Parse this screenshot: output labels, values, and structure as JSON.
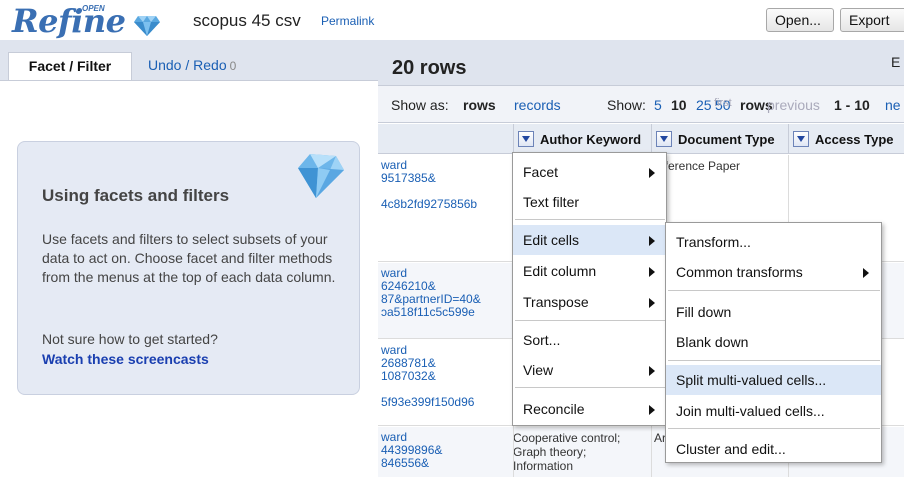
{
  "app": {
    "logo_text": "Refine",
    "logo_superscript": "OPEN",
    "project_title": "scopus 45 csv",
    "permalink": "Permalink",
    "open_button": "Open...",
    "export_button": "Export"
  },
  "left_panel": {
    "tab_facet": "Facet / Filter",
    "tab_undo": "Undo / Redo",
    "undo_count": "0",
    "help_title": "Using facets and filters",
    "help_text": "Use facets and filters to select subsets of your data to act on. Choose facet and filter methods from the menus at the top of each data column.",
    "help_question": "Not sure how to get started?",
    "help_link": "Watch these screencasts"
  },
  "data_area": {
    "rows_count": "20 rows",
    "rows_extra": "E",
    "view": {
      "show_as_label": "Show as:",
      "rows": "rows",
      "records": "records",
      "show_label": "Show:",
      "size_5": "5",
      "size_10": "10",
      "size_25": "25",
      "size_50": "50",
      "size_rows": "rows",
      "overlap_first": "first",
      "previous": "previous",
      "range": "1 - 10",
      "next": "ne"
    },
    "columns": [
      {
        "label": "Author Keyword"
      },
      {
        "label": "Document Type"
      },
      {
        "label": "Access Type"
      }
    ],
    "rows": [
      {
        "lines": [
          "ward",
          "9517385&",
          "",
          "4c8b2fd9275856b"
        ],
        "doc_type": "nference Paper"
      },
      {
        "lines": [
          "ward",
          "6246210&",
          "87&partnerID=40&",
          "ɔa518f11c5c599e"
        ]
      },
      {
        "lines": [
          "ward",
          "2688781&",
          "1087032&",
          "",
          "5f93e399f150d96"
        ]
      },
      {
        "lines": [
          "ward",
          "44399896&",
          "846556&"
        ],
        "keywords": [
          "Cooperative control;",
          "Graph theory;",
          "Information"
        ],
        "doc_type": "Ar"
      }
    ]
  },
  "column_menu": {
    "items": [
      {
        "label": "Facet",
        "submenu": true
      },
      {
        "label": "Text filter",
        "submenu": false
      },
      {
        "label": "Edit cells",
        "submenu": true,
        "highlighted": true
      },
      {
        "label": "Edit column",
        "submenu": true
      },
      {
        "label": "Transpose",
        "submenu": true
      },
      {
        "label": "Sort...",
        "submenu": false
      },
      {
        "label": "View",
        "submenu": true
      },
      {
        "label": "Reconcile",
        "submenu": true
      }
    ]
  },
  "edit_cells_menu": {
    "items": [
      {
        "label": "Transform...",
        "submenu": false
      },
      {
        "label": "Common transforms",
        "submenu": true
      },
      {
        "label": "Fill down",
        "submenu": false
      },
      {
        "label": "Blank down",
        "submenu": false
      },
      {
        "label": "Split multi-valued cells...",
        "submenu": false,
        "highlighted": true
      },
      {
        "label": "Join multi-valued cells...",
        "submenu": false
      },
      {
        "label": "Cluster and edit...",
        "submenu": false
      }
    ]
  },
  "colors": {
    "panel_bg": "#dfe4ee",
    "link": "#1a5fb4",
    "menu_highlight": "#dbe7f7"
  }
}
